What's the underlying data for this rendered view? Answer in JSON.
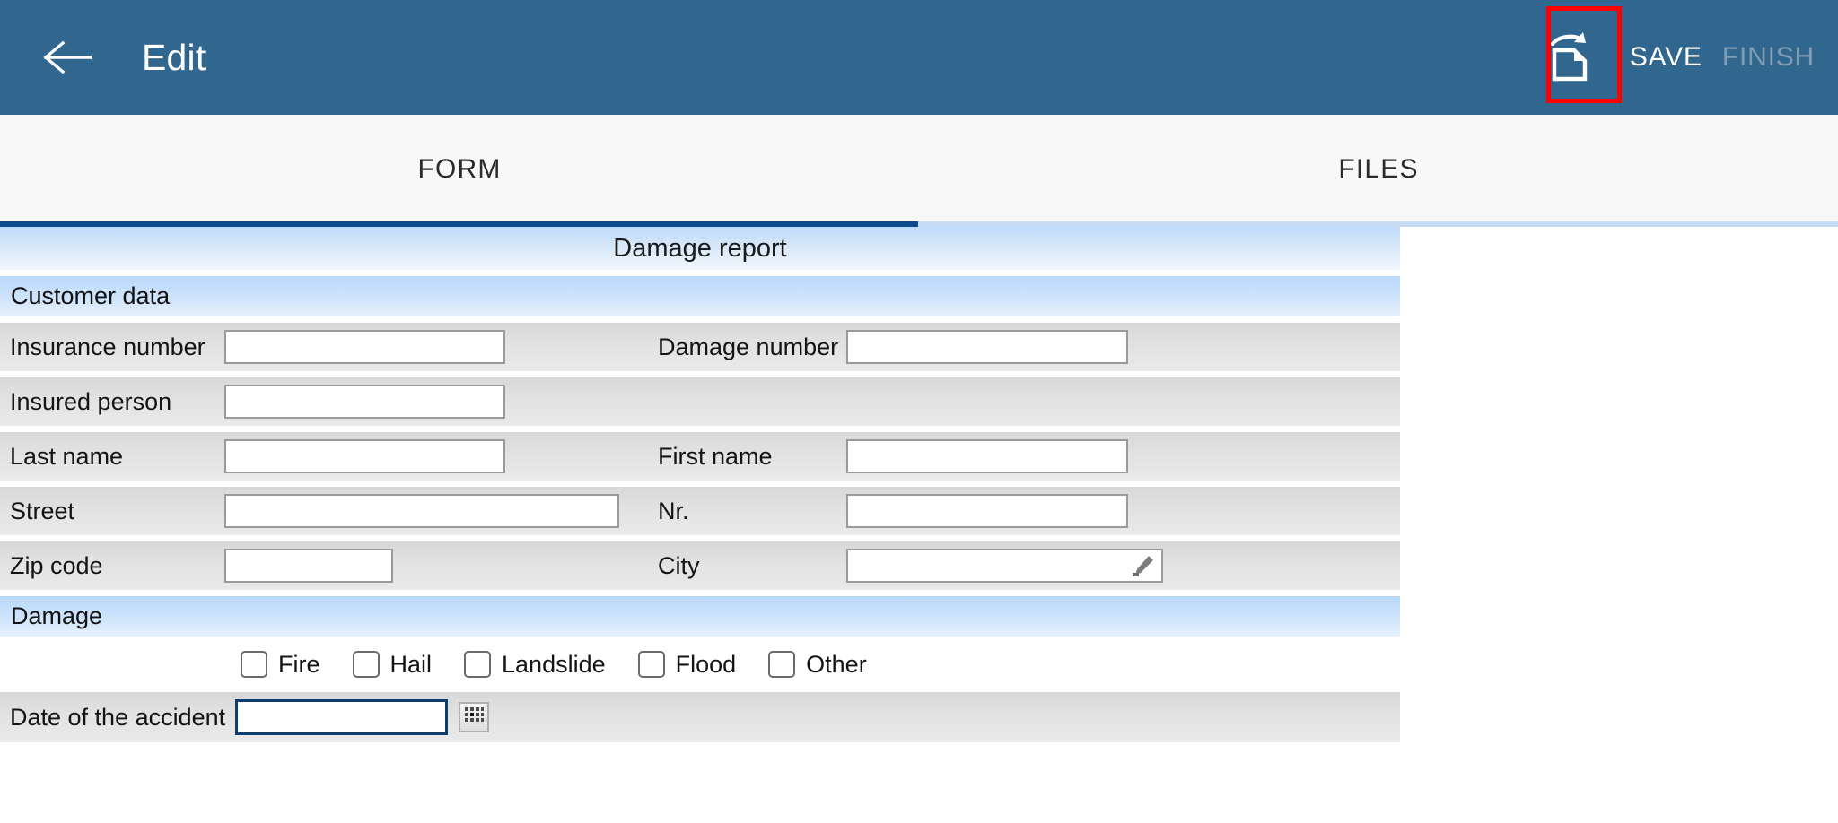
{
  "appbar": {
    "back_icon": "arrow-left-icon",
    "title": "Edit",
    "share_icon": "document-share-icon",
    "save_label": "SAVE",
    "finish_label": "FINISH",
    "background_color": "#31678f",
    "highlight_color": "#ff0000"
  },
  "tabs": [
    {
      "label": "FORM",
      "active": true
    },
    {
      "label": "FILES",
      "active": false
    }
  ],
  "form": {
    "title": "Damage report",
    "sections": [
      {
        "header": "Customer data",
        "rows": [
          {
            "left_label": "Insurance number",
            "left_value": "",
            "right_label": "Damage number",
            "right_value": ""
          },
          {
            "left_label": "Insured person",
            "left_value": "",
            "right_label": "",
            "right_value": ""
          },
          {
            "left_label": "Last name",
            "left_value": "",
            "right_label": "First name",
            "right_value": ""
          },
          {
            "left_label": "Street",
            "left_value": "",
            "right_label": "Nr.",
            "right_value": ""
          },
          {
            "left_label": "Zip code",
            "left_value": "",
            "right_label": "City",
            "right_value": "",
            "right_icon": "pencil-edit-icon"
          }
        ]
      },
      {
        "header": "Damage",
        "checkboxes": [
          {
            "label": "Fire",
            "checked": false
          },
          {
            "label": "Hail",
            "checked": false
          },
          {
            "label": "Landslide",
            "checked": false
          },
          {
            "label": "Flood",
            "checked": false
          },
          {
            "label": "Other",
            "checked": false
          }
        ],
        "date_row": {
          "label": "Date of the accident",
          "value": "",
          "picker_icon": "calendar-picker-icon",
          "focused": true
        }
      }
    ]
  },
  "colors": {
    "appbar": "#31678f",
    "tab_active_underline": "#0d4c8c",
    "tab_inactive_underline": "#c6dcf5",
    "section_header_blue": "#b9d8fb",
    "row_gray": "#e2e2e2",
    "focus_border": "#0d3f6e"
  }
}
